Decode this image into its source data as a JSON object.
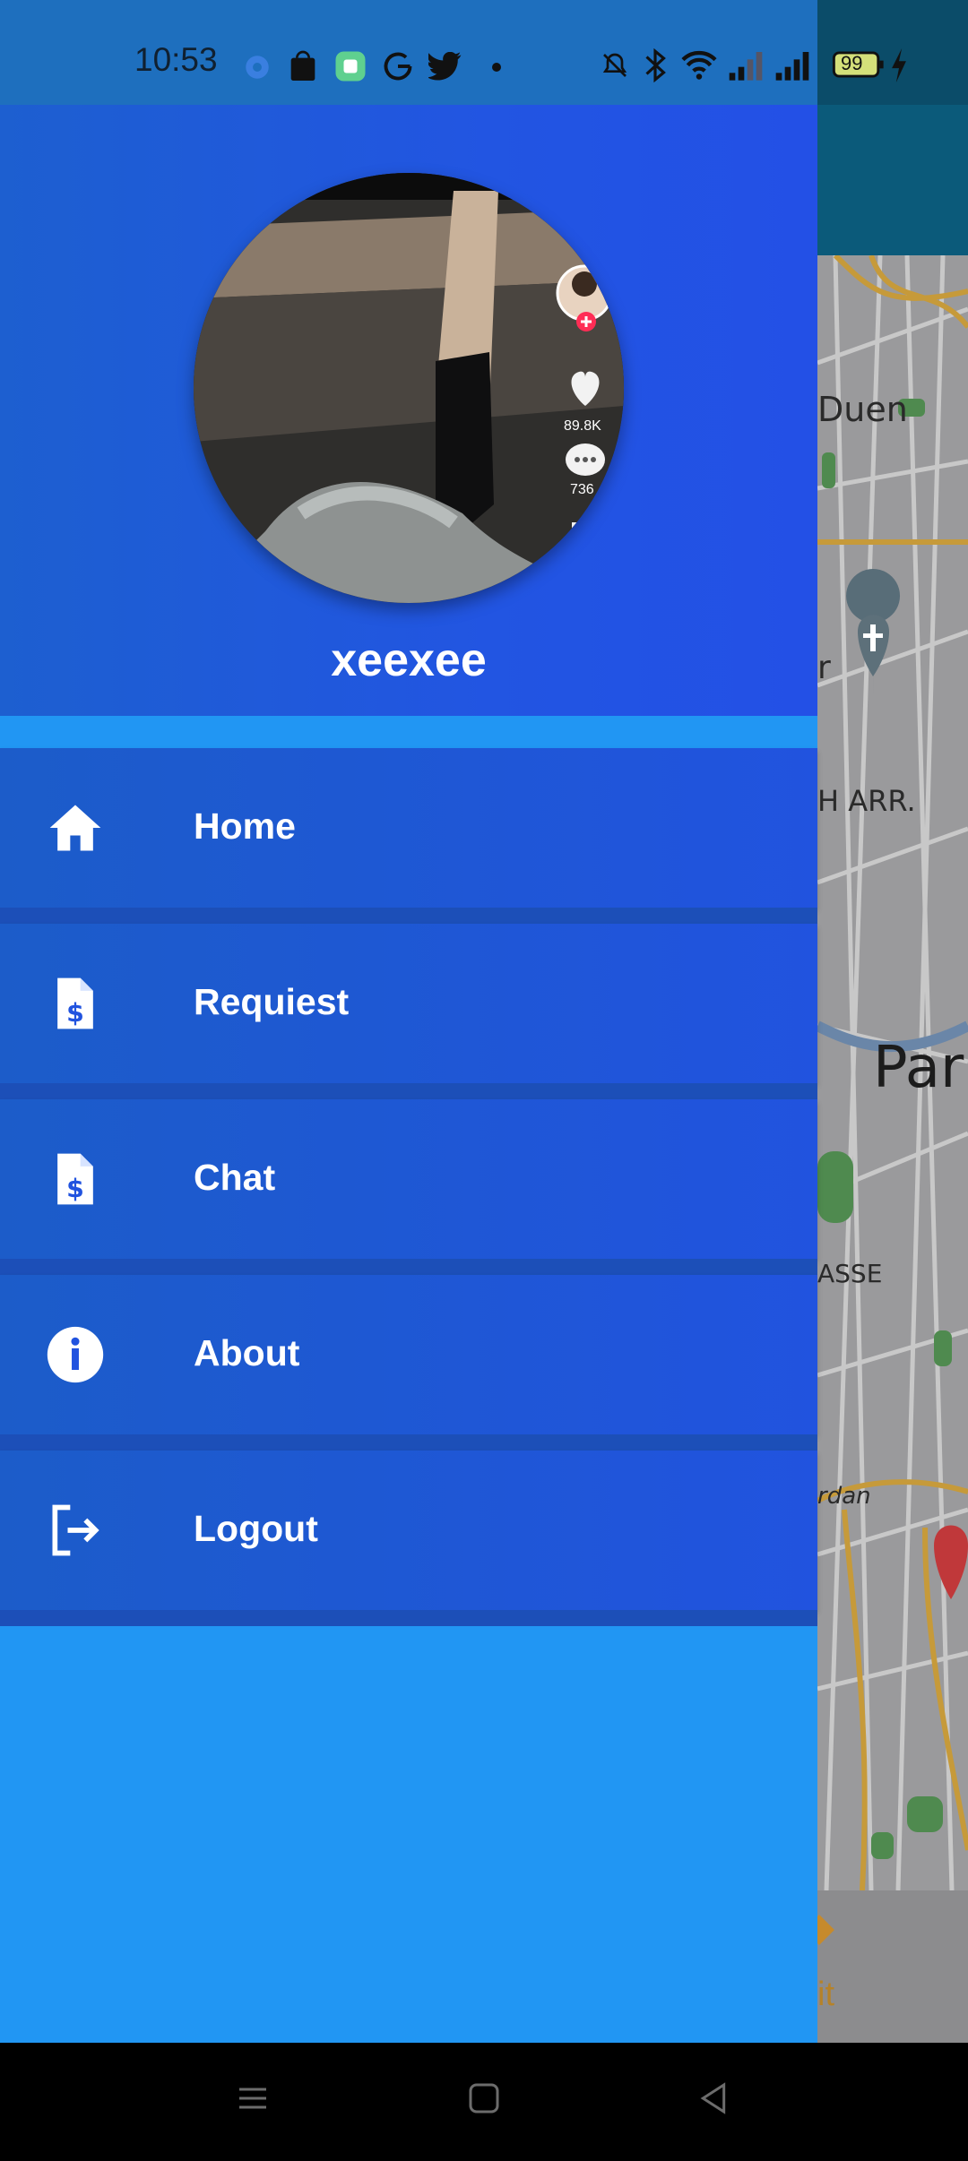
{
  "status_bar": {
    "time": "10:53",
    "battery": "99",
    "icons": [
      "settings-icon",
      "shopping-bag-icon",
      "app-icon",
      "google-icon",
      "twitter-icon",
      "dot-icon",
      "mute-icon",
      "bluetooth-icon",
      "wifi-icon",
      "signal-icon",
      "signal-icon",
      "battery-icon",
      "charging-icon"
    ]
  },
  "drawer": {
    "username": "xeexee",
    "avatar_overlay": {
      "likes": "89.8K",
      "comments": "736"
    },
    "menu": [
      {
        "label": "Home",
        "icon": "home-icon"
      },
      {
        "label": "Requiest",
        "icon": "invoice-dollar-icon"
      },
      {
        "label": "Chat",
        "icon": "invoice-dollar-icon"
      },
      {
        "label": "About",
        "icon": "info-icon"
      },
      {
        "label": "Logout",
        "icon": "logout-icon"
      }
    ]
  },
  "map": {
    "labels": [
      "Duen",
      "r",
      "H ARR.",
      "Par",
      "ASSE",
      "rdan"
    ],
    "bottom_text": "it"
  },
  "nav_bar": {
    "buttons": [
      "menu-button",
      "home-button",
      "back-button"
    ]
  }
}
